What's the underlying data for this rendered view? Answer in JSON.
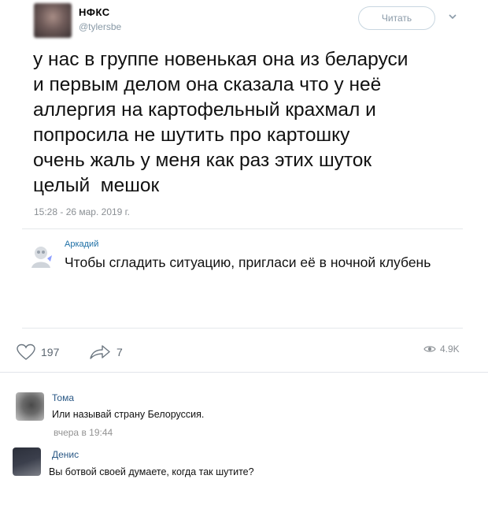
{
  "tweet": {
    "author_name": "НФКС",
    "author_handle": "@tylersbe",
    "follow_label": "Читать",
    "text_lines": [
      "у нас в группе новенькая она из беларуси",
      "и первым делом она сказала что у неё",
      "аллергия на картофельный крахмал и",
      "попросила не шутить про картошку",
      "очень жаль у меня как раз этих шуток",
      "целый  мешок"
    ],
    "timestamp": "15:28 - 26 мар. 2019 г.",
    "reply": {
      "name": "Аркадий",
      "text": "Чтобы сгладить ситуацию, пригласи её в ночной клубень"
    },
    "likes": "197",
    "reposts": "7",
    "views": "4.9K"
  },
  "comments": [
    {
      "name": "Тома",
      "text": "Или называй страну Белоруссия.",
      "time": "вчера в 19:44"
    },
    {
      "name": "Денис",
      "text": "Вы ботвой своей думаете, когда так шутите?"
    }
  ],
  "icons": {
    "like": "heart-icon",
    "repost": "share-arrow-icon",
    "views": "eye-icon",
    "menu": "chevron-down-icon"
  },
  "colors": {
    "link": "#2a5885",
    "muted": "#939393",
    "reply_name": "#1d6fa5"
  }
}
